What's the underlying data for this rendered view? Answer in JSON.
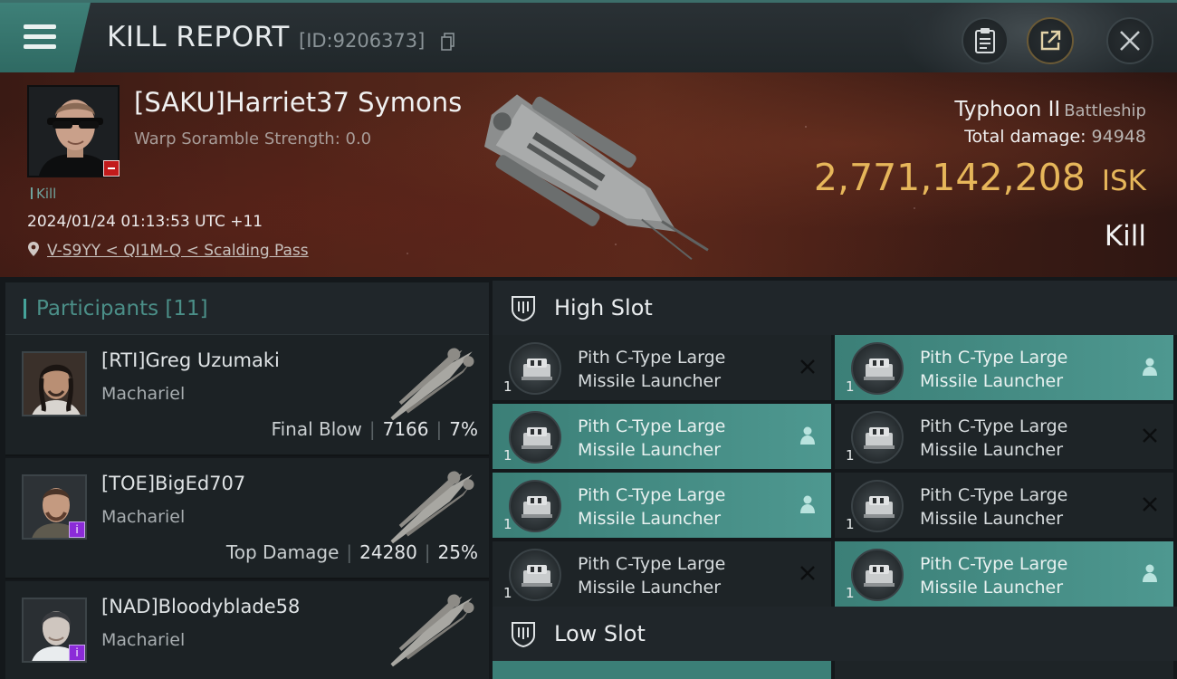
{
  "header": {
    "title": "KILL REPORT",
    "report_id": "[ID:9206373]",
    "icons": [
      "menu-icon",
      "copy-icon",
      "clipboard-icon",
      "share-icon",
      "close-icon"
    ]
  },
  "victim": {
    "name": "[SAKU]Harriet37 Symons",
    "warp_scramble": "Warp Soramble Strength: 0.0",
    "tag": "Kill",
    "datetime": "2024/01/24 01:13:53 UTC +11",
    "location": "V-S9YY < QI1M-Q < Scalding Pass",
    "ship_name": "Typhoon II",
    "ship_class": "Battleship",
    "damage_label": "Total damage:",
    "damage_value": "94948",
    "isk_value": "2,771,142,208",
    "isk_currency": "ISK",
    "result": "Kill"
  },
  "participants": {
    "label": "Participants",
    "count": "[11]",
    "items": [
      {
        "name": "[RTI]Greg Uzumaki",
        "ship": "Machariel",
        "role": "Final Blow",
        "damage": "7166",
        "percent": "7%"
      },
      {
        "name": "[TOE]BigEd707",
        "ship": "Machariel",
        "role": "Top Damage",
        "damage": "24280",
        "percent": "25%"
      },
      {
        "name": "[NAD]Bloodyblade58",
        "ship": "Machariel",
        "role": "",
        "damage": "",
        "percent": ""
      }
    ]
  },
  "fitting": {
    "high_slot_label": "High Slot",
    "low_slot_label": "Low Slot",
    "high_slots": [
      {
        "line1": "Pith C-Type Large",
        "line2": "Missile Launcher",
        "qty": "1",
        "state": "destroyed"
      },
      {
        "line1": "Pith C-Type Large",
        "line2": "Missile Launcher",
        "qty": "1",
        "state": "dropped"
      },
      {
        "line1": "Pith C-Type Large",
        "line2": "Missile Launcher",
        "qty": "1",
        "state": "dropped"
      },
      {
        "line1": "Pith C-Type Large",
        "line2": "Missile Launcher",
        "qty": "1",
        "state": "destroyed"
      },
      {
        "line1": "Pith C-Type Large",
        "line2": "Missile Launcher",
        "qty": "1",
        "state": "dropped"
      },
      {
        "line1": "Pith C-Type Large",
        "line2": "Missile Launcher",
        "qty": "1",
        "state": "destroyed"
      },
      {
        "line1": "Pith C-Type Large",
        "line2": "Missile Launcher",
        "qty": "1",
        "state": "destroyed"
      },
      {
        "line1": "Pith C-Type Large",
        "line2": "Missile Launcher",
        "qty": "1",
        "state": "dropped"
      }
    ]
  },
  "colors": {
    "accent_teal": "#3e8078",
    "isk_gold": "#e6b65a",
    "victim_flag_red": "#c21b1b",
    "corp_badge_purple": "#8b2bd8"
  }
}
